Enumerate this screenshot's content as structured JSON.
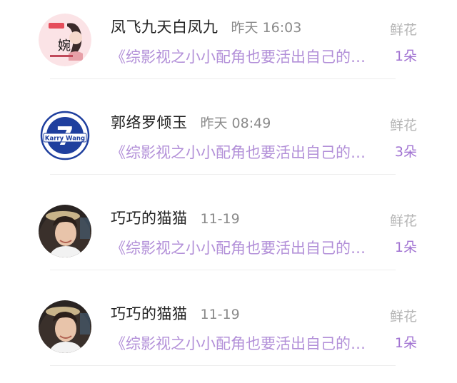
{
  "entries": [
    {
      "name": "凤飞九天白凤九",
      "time": "昨天 16:03",
      "gift_label": "鲜花",
      "book": "《综影视之小小配角也要活出自己的…",
      "count": "1朵",
      "avatar_icon": "anime-girl-avatar",
      "avatar_text": "婉"
    },
    {
      "name": "郭络罗倾玉",
      "time": "昨天 08:49",
      "gift_label": "鲜花",
      "book": "《综影视之小小配角也要活出自己的…",
      "count": "3朵",
      "avatar_icon": "karry-wang-7-badge-avatar",
      "avatar_text": "Karry Wang",
      "avatar_number": "7"
    },
    {
      "name": "巧巧的猫猫",
      "time": "11-19",
      "gift_label": "鲜花",
      "book": "《综影视之小小配角也要活出自己的…",
      "count": "1朵",
      "avatar_icon": "woman-photo-avatar"
    },
    {
      "name": "巧巧的猫猫",
      "time": "11-19",
      "gift_label": "鲜花",
      "book": "《综影视之小小配角也要活出自己的…",
      "count": "1朵",
      "avatar_icon": "woman-photo-avatar"
    }
  ],
  "colors": {
    "name": "#222222",
    "time": "#8a8a8a",
    "gift_label": "#b5b5b5",
    "book": "#b28fd8",
    "count": "#a173d2",
    "badge_blue": "#1f3f9e"
  }
}
